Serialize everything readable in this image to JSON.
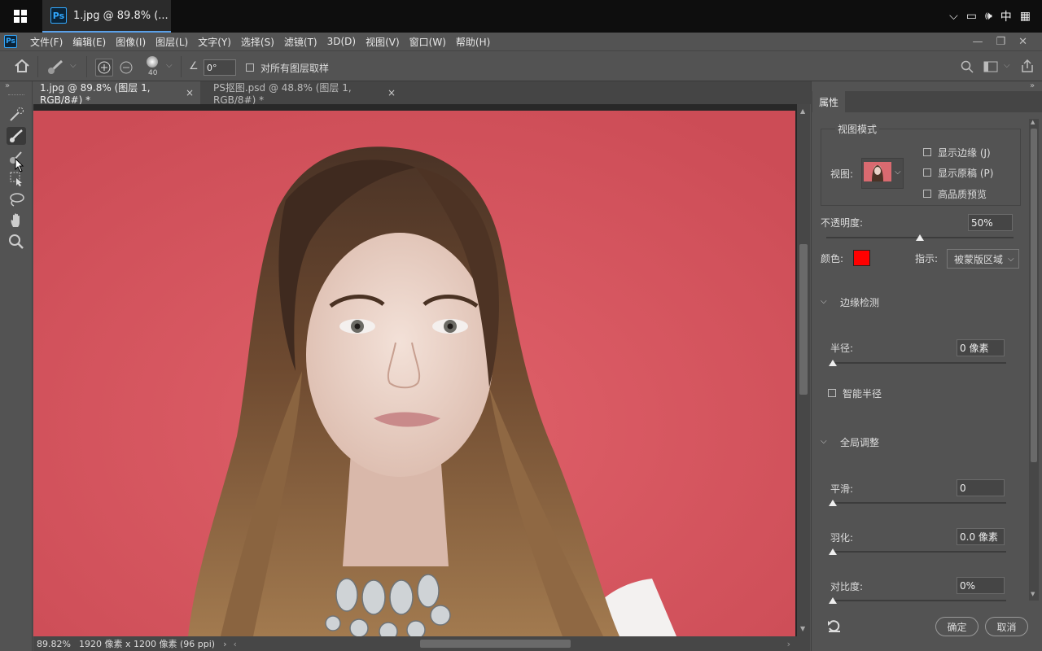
{
  "os": {
    "tab_title": "1.jpg @ 89.8% (...",
    "tray_lang": "中"
  },
  "menu": [
    "文件(F)",
    "编辑(E)",
    "图像(I)",
    "图层(L)",
    "文字(Y)",
    "选择(S)",
    "滤镜(T)",
    "3D(D)",
    "视图(V)",
    "窗口(W)",
    "帮助(H)"
  ],
  "options": {
    "brush_size": "40",
    "angle": "0°",
    "sample_all_label": "对所有图层取样"
  },
  "tabs": [
    {
      "label": "1.jpg @ 89.8% (图层 1, RGB/8#) *",
      "close": "×"
    },
    {
      "label": "PS抠图.psd @ 48.8% (图层 1, RGB/8#) *",
      "close": "×"
    }
  ],
  "status": {
    "zoom": "89.82%",
    "info": "1920 像素 x 1200 像素 (96 ppi)"
  },
  "panel": {
    "tab": "属性",
    "view_mode_title": "视图模式",
    "view_label": "视图:",
    "show_edge": "显示边缘 (J)",
    "show_original": "显示原稿 (P)",
    "hq_preview": "高品质预览",
    "opacity_label": "不透明度:",
    "opacity_value": "50%",
    "opacity_level": 0.5,
    "color_label": "颜色:",
    "color_swatch": "#ff0000",
    "indicate_label": "指示:",
    "indicate_value": "被蒙版区域",
    "edge_detect_title": "边缘检测",
    "radius_label": "半径:",
    "radius_value": "0 像素",
    "smart_radius": "智能半径",
    "global_title": "全局调整",
    "smooth_label": "平滑:",
    "smooth_value": "0",
    "feather_label": "羽化:",
    "feather_value": "0.0 像素",
    "contrast_label": "对比度:",
    "contrast_value": "0%",
    "ok_button": "确定",
    "cancel_button": "取消"
  },
  "colors": {
    "canvas_bg": "#d5505a",
    "accent": "#31a8ff"
  }
}
